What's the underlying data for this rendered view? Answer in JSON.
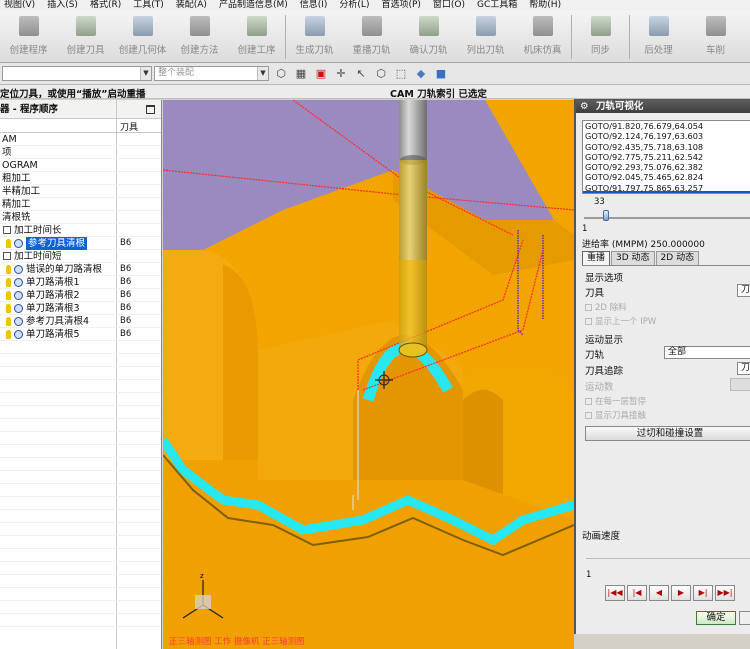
{
  "menu": [
    "视图(V)",
    "插入(S)",
    "格式(R)",
    "工具(T)",
    "装配(A)",
    "产品制造信息(M)",
    "信息(I)",
    "分析(L)",
    "首选项(P)",
    "窗口(O)",
    "GC工具箱",
    "帮助(H)"
  ],
  "toolbar_big": [
    {
      "label": "创建程序",
      "icon": "create-program-icon"
    },
    {
      "label": "创建刀具",
      "icon": "create-tool-icon"
    },
    {
      "label": "创建几何体",
      "icon": "create-geometry-icon"
    },
    {
      "label": "创建方法",
      "icon": "create-method-icon"
    },
    {
      "label": "创建工序",
      "icon": "create-operation-icon"
    },
    {
      "label": "生成刀轨",
      "icon": "generate-toolpath-icon"
    },
    {
      "label": "重播刀轨",
      "icon": "replay-toolpath-icon"
    },
    {
      "label": "确认刀轨",
      "icon": "verify-toolpath-icon"
    },
    {
      "label": "列出刀轨",
      "icon": "list-toolpath-icon"
    },
    {
      "label": "机床仿真",
      "icon": "machine-simulation-icon"
    },
    {
      "label": "同步",
      "icon": "synchronize-icon"
    },
    {
      "label": "后处理",
      "icon": "postprocess-icon"
    },
    {
      "label": "车削",
      "icon": "turning-icon"
    }
  ],
  "toolbar_small": {
    "filter_placeholder": "",
    "assembly_filter": "整个装配"
  },
  "cue": {
    "left": "定位刀具，或使用“播放”启动重播",
    "center": "CAM 刀轨索引 已选定"
  },
  "navigator": {
    "title": "器 - 程序顺序",
    "col_name": "",
    "col_tool": "刀具",
    "rows": [
      {
        "name": "AM",
        "tool": "",
        "indent": 2,
        "kind": "text"
      },
      {
        "name": "项",
        "tool": "",
        "indent": 2,
        "kind": "text"
      },
      {
        "name": "OGRAM",
        "tool": "",
        "indent": 2,
        "kind": "text"
      },
      {
        "name": "粗加工",
        "tool": "",
        "indent": 2,
        "kind": "text"
      },
      {
        "name": "半精加工",
        "tool": "",
        "indent": 2,
        "kind": "text"
      },
      {
        "name": "精加工",
        "tool": "",
        "indent": 2,
        "kind": "text"
      },
      {
        "name": "清根铣",
        "tool": "",
        "indent": 2,
        "kind": "text"
      },
      {
        "name": "加工时间长",
        "tool": "",
        "indent": 2,
        "kind": "group"
      },
      {
        "name": "参考刀具清根",
        "tool": "B6",
        "indent": 2,
        "kind": "op",
        "selected": true
      },
      {
        "name": "加工时间短",
        "tool": "",
        "indent": 2,
        "kind": "group"
      },
      {
        "name": "错误的单刀路清根",
        "tool": "B6",
        "indent": 2,
        "kind": "op"
      },
      {
        "name": "单刀路清根1",
        "tool": "B6",
        "indent": 2,
        "kind": "op"
      },
      {
        "name": "单刀路清根2",
        "tool": "B6",
        "indent": 2,
        "kind": "op"
      },
      {
        "name": "单刀路清根3",
        "tool": "B6",
        "indent": 2,
        "kind": "op"
      },
      {
        "name": "参考刀具清根4",
        "tool": "B6",
        "indent": 2,
        "kind": "op"
      },
      {
        "name": "单刀路清根5",
        "tool": "B6",
        "indent": 2,
        "kind": "op"
      }
    ]
  },
  "viewport": {
    "status_text": "正三轴测图 工作 摄像机 正三轴测图"
  },
  "dialog": {
    "title": "刀轨可视化",
    "goto_lines": [
      "GOTO/91.820,76.679,64.054",
      "GOTO/92.124,76.197,63.603",
      "GOTO/92.435,75.718,63.108",
      "GOTO/92.775,75.211,62.542",
      "GOTO/92.293,75.076,62.382",
      "GOTO/92.045,75.465,62.824",
      "GOTO/91.797,75.865,63.257"
    ],
    "slider_max": "33",
    "slider_min": "1",
    "slider_value_fraction": 0.12,
    "feedrate_label": "进给率 (MMPM) 250.000000",
    "tabs": [
      "重播",
      "3D 动态",
      "2D 动态"
    ],
    "active_tab": 0,
    "display_options_label": "显示选项",
    "tool_label": "刀具",
    "tool_value": "刀",
    "check_2d": "2D 除料",
    "check_prev_ipw": "显示上一个 IPW",
    "motion_display_label": "运动显示",
    "toolpath_label": "刀轨",
    "toolpath_value": "全部",
    "tool_trace_label": "刀具追踪",
    "tool_trace_value": "刀",
    "motion_count_label": "运动数",
    "check_pause_each_layer": "在每一层暂停",
    "check_show_contact": "显示刀具接触",
    "gouge_button": "过切和碰撞设置",
    "anim_speed_label": "动画速度",
    "anim_speed_value": "1",
    "ok_button": "确定"
  },
  "colors": {
    "workpiece": "#f2a400",
    "workpiece_dark": "#c77c00",
    "top_face": "#9b8ac0",
    "cyan_path": "#27e8f2",
    "tool_body": "#d8b820",
    "toolpath_red": "#ff2a2a",
    "selection_blue": "#0a64d6"
  }
}
